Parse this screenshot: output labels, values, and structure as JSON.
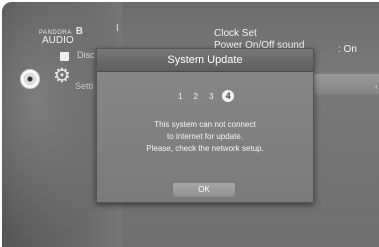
{
  "background": {
    "brand_small": "PANDORA",
    "brand_letter": "B",
    "category": "AUDIO",
    "disc_label": "Disc",
    "settings_label": "Setti",
    "divider_mark": "I"
  },
  "menu": {
    "clock_set": "Clock Set",
    "power_on_off_sound": "Power On/Off sound",
    "power_value": ": On",
    "right_mark": "‹"
  },
  "dialog": {
    "title": "System Update",
    "steps": [
      "1",
      "2",
      "3",
      "4"
    ],
    "active_step": "4",
    "message_lines": [
      "This system can not connect",
      "to internet for update.",
      "Please, check the network setup."
    ],
    "ok_label": "OK"
  },
  "colors": {
    "dialog_bg": "#7a7a7a",
    "text": "#ffffff"
  },
  "icons": {
    "gear": "gear-icon",
    "disc": "disc-icon"
  }
}
